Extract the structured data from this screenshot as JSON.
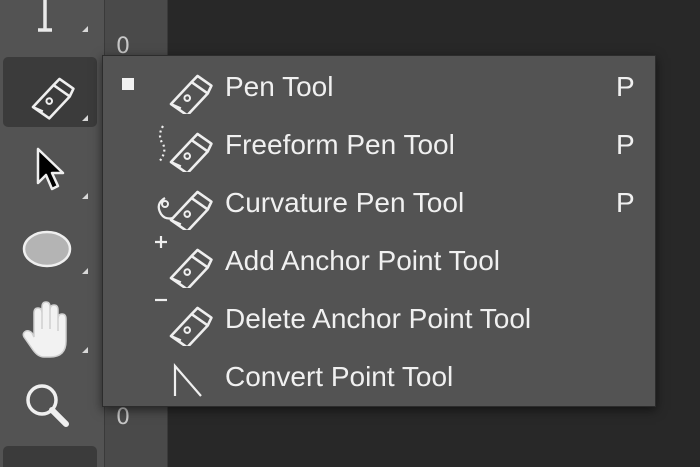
{
  "toolbar": {
    "tools": [
      {
        "name": "type-tool",
        "icon": "type-icon"
      },
      {
        "name": "pen-tool",
        "icon": "pen-icon",
        "active": true
      },
      {
        "name": "path-selection-tool",
        "icon": "arrow-icon"
      },
      {
        "name": "ellipse-tool",
        "icon": "ellipse-icon"
      },
      {
        "name": "hand-tool",
        "icon": "hand-icon"
      },
      {
        "name": "zoom-tool",
        "icon": "magnifier-icon"
      }
    ]
  },
  "ruler": {
    "top_label": "0",
    "bottom_label": "0"
  },
  "flyout_menu": {
    "items": [
      {
        "label": "Pen Tool",
        "shortcut": "P",
        "selected": true,
        "icon": "pen-icon"
      },
      {
        "label": "Freeform Pen Tool",
        "shortcut": "P",
        "icon": "freeform-pen-icon"
      },
      {
        "label": "Curvature Pen Tool",
        "shortcut": "P",
        "icon": "curvature-pen-icon"
      },
      {
        "label": "Add Anchor Point Tool",
        "shortcut": "",
        "icon": "add-anchor-point-icon"
      },
      {
        "label": "Delete Anchor Point Tool",
        "shortcut": "",
        "icon": "delete-anchor-point-icon"
      },
      {
        "label": "Convert Point Tool",
        "shortcut": "",
        "icon": "convert-point-icon"
      }
    ]
  },
  "colors": {
    "menu_bg": "#535353",
    "canvas_bg": "#282828",
    "text": "#f0f0f0"
  }
}
